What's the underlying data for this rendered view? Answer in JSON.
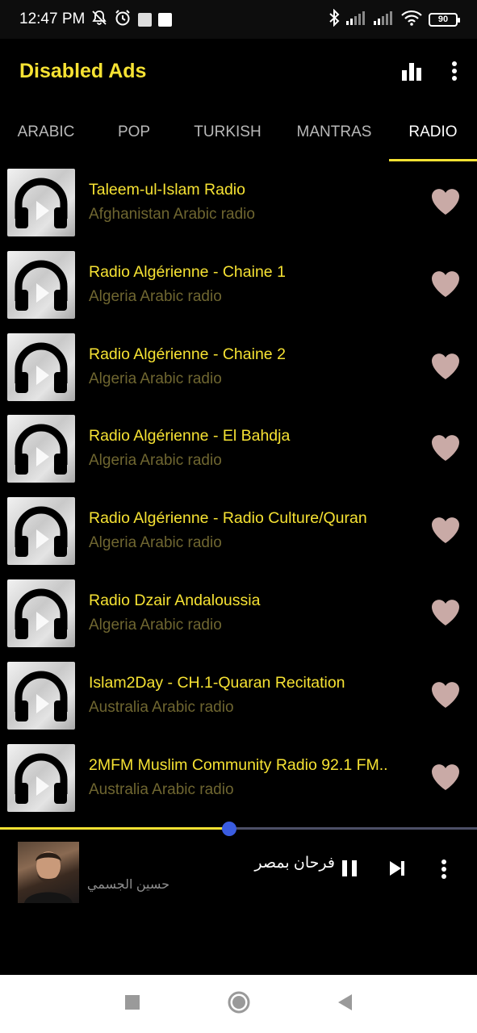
{
  "status_bar": {
    "time": "12:47 PM",
    "battery": "90",
    "left_icons": [
      "mute-bell-icon",
      "alarm-icon",
      "notification-square-icon",
      "notification-square-icon"
    ],
    "right_icons": [
      "bluetooth-icon",
      "signal-icon",
      "signal-icon",
      "wifi-icon",
      "battery-icon"
    ]
  },
  "app_bar": {
    "title": "Disabled Ads",
    "actions": [
      "equalizer-icon",
      "more-vert-icon"
    ]
  },
  "tabs": [
    {
      "label": "ARABIC",
      "active": false
    },
    {
      "label": "POP",
      "active": false
    },
    {
      "label": "TURKISH",
      "active": false
    },
    {
      "label": "MANTRAS",
      "active": false
    },
    {
      "label": "RADIO",
      "active": true
    }
  ],
  "stations": [
    {
      "name": "Taleem-ul-Islam Radio",
      "subtitle": "Afghanistan Arabic radio"
    },
    {
      "name": "Radio Algérienne - Chaine 1",
      "subtitle": "Algeria Arabic radio"
    },
    {
      "name": "Radio Algérienne - Chaine 2",
      "subtitle": "Algeria Arabic radio"
    },
    {
      "name": "Radio Algérienne - El Bahdja",
      "subtitle": "Algeria Arabic radio"
    },
    {
      "name": "Radio Algérienne - Radio Culture/Quran",
      "subtitle": "Algeria Arabic radio"
    },
    {
      "name": "Radio Dzair Andaloussia",
      "subtitle": "Algeria Arabic radio"
    },
    {
      "name": "Islam2Day - CH.1-Quaran Recitation",
      "subtitle": "Australia Arabic radio"
    },
    {
      "name": "2MFM Muslim Community Radio 92.1 FM..",
      "subtitle": "Australia Arabic radio"
    }
  ],
  "player": {
    "title": "فرحان بمصر",
    "artist": "حسين الجسمي",
    "progress": 0.48,
    "controls": [
      "pause-icon",
      "skip-next-icon",
      "more-vert-icon"
    ]
  },
  "colors": {
    "accent": "#f6e233",
    "subtitle": "#6f6630",
    "heart": "#c9aaa6",
    "progress_thumb": "#3a5ce0"
  },
  "nav_bar": {
    "buttons": [
      "recents-square-icon",
      "home-circle-icon",
      "back-triangle-icon"
    ]
  }
}
